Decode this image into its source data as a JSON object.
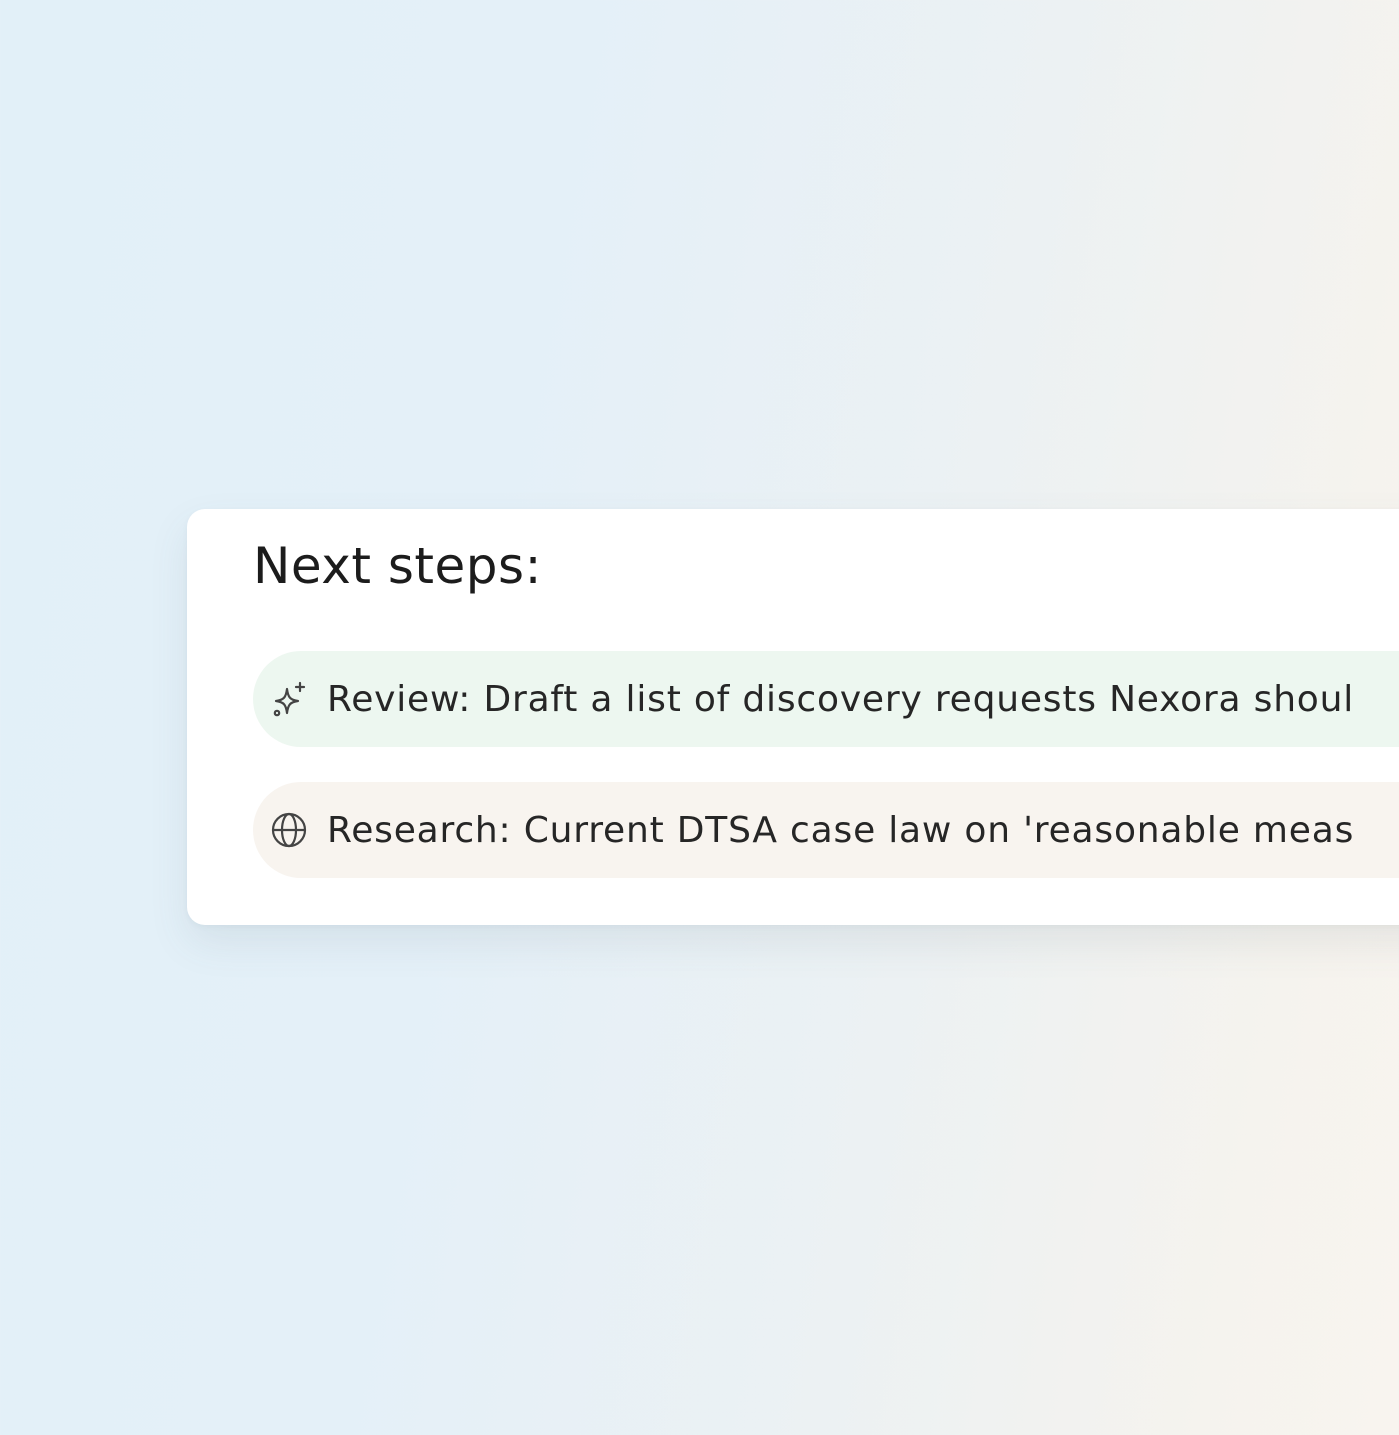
{
  "panel": {
    "title": "Next steps:",
    "steps": [
      {
        "icon": "sparkle-icon",
        "text": "Review: Draft a list of discovery requests Nexora shoul",
        "background": "#edf7f0"
      },
      {
        "icon": "globe-icon",
        "text": "Research: Current DTSA case law on 'reasonable meas",
        "background": "#f8f4ef"
      }
    ]
  },
  "colors": {
    "card": "#ffffff",
    "text": "#1c1c1c",
    "icon": "#444444"
  }
}
